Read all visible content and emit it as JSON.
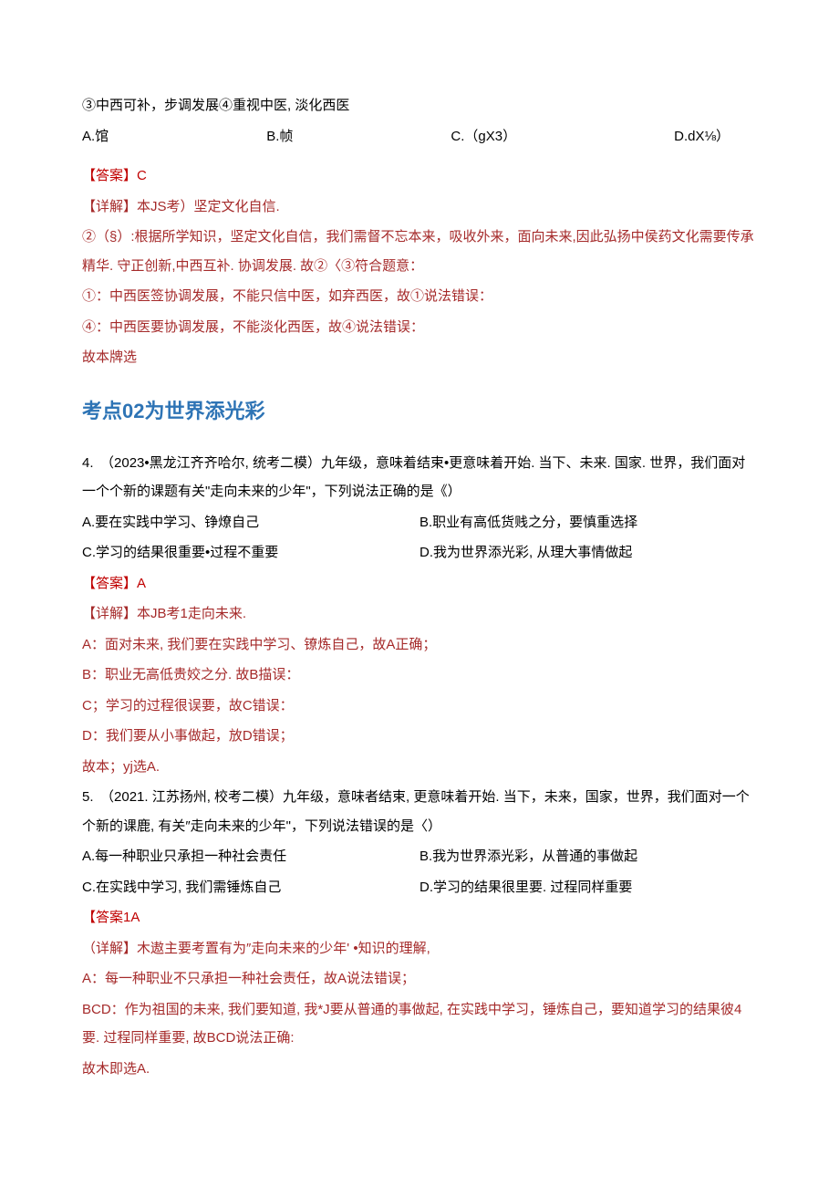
{
  "q3": {
    "stmt3": "③中西可补，步调发展④重视中医, 淡化西医",
    "optA": "A.馆",
    "optB": "B.帧",
    "optC": "C.（gX3）",
    "optD": "D.dX⅛）",
    "ans": "【答案】C",
    "detail_head": "【详解】本JS考）坚定文化自信.",
    "d1": "②（§）:根据所学知识，坚定文化自信，我们需督不忘本来，吸收外来，面向未来,因此弘扬中侯药文化需要传承精华. 守正创新,中西互补. 协调发展. 故②〈③符合题意：",
    "d2": "①：中西医签协调发展，不能只信中医，如弃西医，故①说法错误：",
    "d3": "④：中西医要协调发展，不能淡化西医，故④说法错误：",
    "d4": "故本牌选"
  },
  "heading": "考点02为世界添光彩",
  "q4": {
    "stem": "4.　（2023•黑龙江齐齐哈尔, 统考二模）九年级，意味着结束•更意味着开始. 当下、未来. 国家. 世界，我们面对一个个新的课题有关\"走向未来的少年\"，下列说法正确的是《）",
    "optA": "A.要在实践中学习、铮燎自己",
    "optB": "B.职业有高低货贱之分，要慎重选择",
    "optC": "C.学习的结果很重要•过程不重要",
    "optD": "D.我为世界添光彩, 从理大事情做起",
    "ans": "【答案】A",
    "detail_head": "【详解】本JB考1走向未来.",
    "d1": "A：面对未来, 我们要在实践中学习、镣炼自己，故A正确；",
    "d2": "B：职业无高低贵姣之分. 故B描误：",
    "d3": "C；学习的过程很误要，故C错误：",
    "d4": "D：我们要从小事做起，放D错误；",
    "d5": "故本；yj选A."
  },
  "q5": {
    "stem": "5.　（2021. 江苏扬州, 校考二模）九年级，意味者结束, 更意味着开始. 当下，未来，国家，世界，我们面对一个个新的课鹿, 有关″走向未来的少年\"，下列说法错误的是〈）",
    "optA": "A.每一种职业只承担一种社会责任",
    "optB": "B.我为世界添光彩，从普通的事做起",
    "optC": "C.在实践中学习, 我们需锤炼自己",
    "optD": "D.学习的结果很里要. 过程同样重要",
    "ans": "【答案1A",
    "detail_head": "（详解】木遨主要考置有为″走向未来的少年' •知识的理解,",
    "d1": "A：每一种职业不只承担一种社会责任，故A说法错误；",
    "d2": "BCD：作为祖国的未来, 我们要知道, 我*J要从普通的事做起, 在实践中学习，锤炼自己，要知道学习的结果彼4要. 过程同样重要, 故BCD说法正确:",
    "d3": "故木即选A."
  }
}
